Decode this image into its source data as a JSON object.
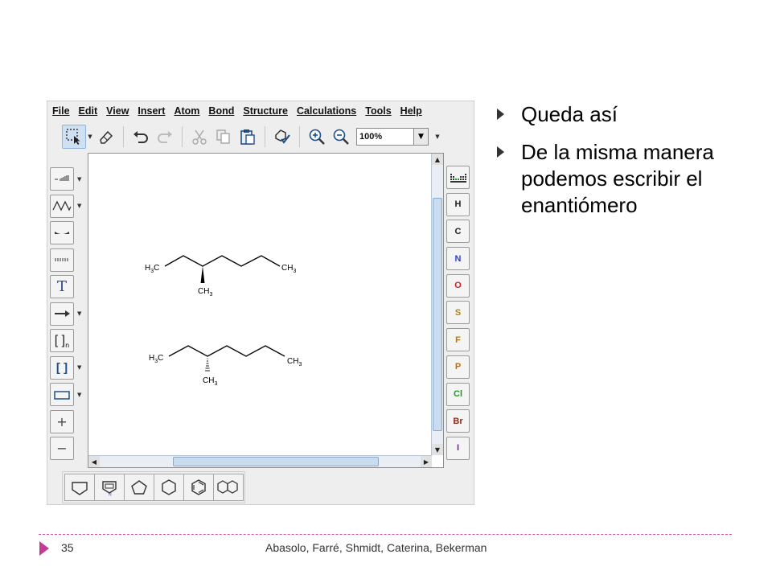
{
  "app": {
    "menu": [
      "File",
      "Edit",
      "View",
      "Insert",
      "Atom",
      "Bond",
      "Structure",
      "Calculations",
      "Tools",
      "Help"
    ],
    "zoom": "100%"
  },
  "left_tools": {
    "text_tool": "T",
    "sgroup": "[ ]",
    "repeat_label": "[ ]",
    "repeat_sub": "n",
    "plus": "+",
    "minus": "−"
  },
  "elements": [
    {
      "symbol": "H",
      "color": "#222222"
    },
    {
      "symbol": "C",
      "color": "#222222"
    },
    {
      "symbol": "N",
      "color": "#2f3fd0"
    },
    {
      "symbol": "O",
      "color": "#d02020"
    },
    {
      "symbol": "S",
      "color": "#b08800"
    },
    {
      "symbol": "F",
      "color": "#b87a00"
    },
    {
      "symbol": "P",
      "color": "#c07000"
    },
    {
      "symbol": "Cl",
      "color": "#1f9a1f"
    },
    {
      "symbol": "Br",
      "color": "#8a2a1a"
    },
    {
      "symbol": "I",
      "color": "#7a1a9a"
    }
  ],
  "molecules": {
    "wedge": {
      "left": "H3C",
      "right": "CH3",
      "sub": "CH3"
    },
    "hash": {
      "left": "H3C",
      "right": "CH3",
      "sub": "CH3"
    }
  },
  "slide": {
    "bullets": [
      "Queda así",
      "De la misma manera podemos escribir el enantiómero"
    ]
  },
  "footer": {
    "page": "35",
    "authors": "Abasolo, Farré, Shmidt, Caterina, Bekerman"
  },
  "colors": {
    "accent": "#c43a97",
    "footer_line": "#d64ea8"
  }
}
